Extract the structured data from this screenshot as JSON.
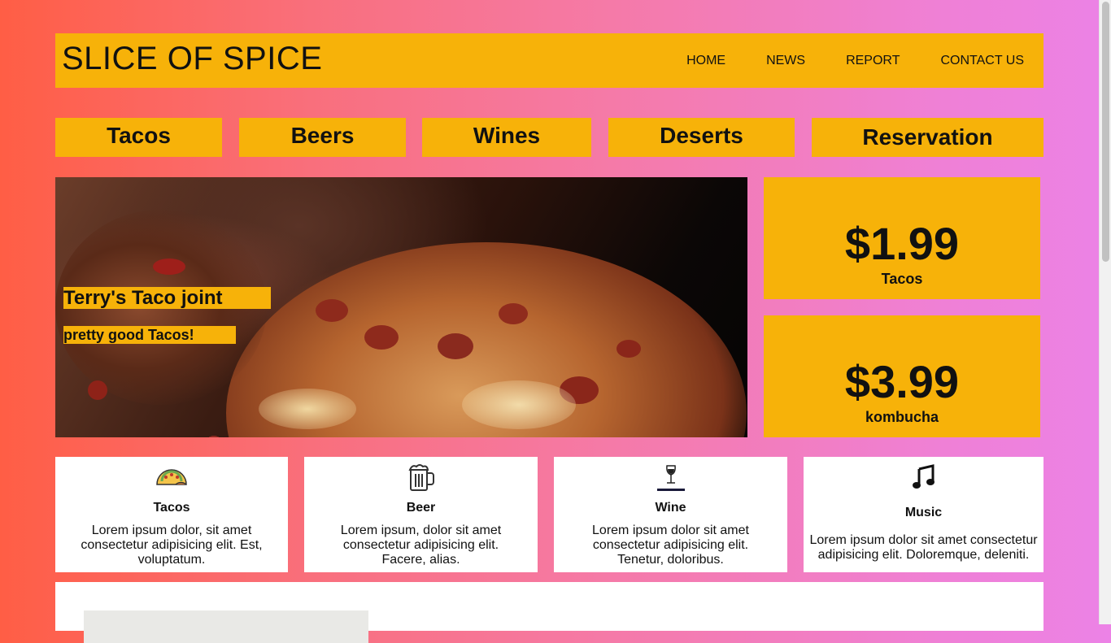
{
  "brand": "SLICE OF SPICE",
  "nav": [
    "HOME",
    "NEWS",
    "REPORT",
    "CONTACT US"
  ],
  "categories": [
    "Tacos",
    "Beers",
    "Wines",
    "Deserts",
    "Reservation"
  ],
  "hero": {
    "title": "Terry's Taco joint",
    "tagline": "pretty good Tacos!"
  },
  "prices": [
    {
      "amount": "$1.99",
      "name": "Tacos"
    },
    {
      "amount": "$3.99",
      "name": "kombucha"
    }
  ],
  "cards": [
    {
      "icon": "taco-icon",
      "title": "Tacos",
      "text": "Lorem ipsum dolor, sit amet consectetur adipisicing elit. Est, voluptatum."
    },
    {
      "icon": "beer-icon",
      "title": "Beer",
      "text": "Lorem ipsum, dolor sit amet consectetur adipisicing elit. Facere, alias."
    },
    {
      "icon": "wine-icon",
      "title": "Wine",
      "text": "Lorem ipsum dolor sit amet consectetur adipisicing elit. Tenetur, doloribus."
    },
    {
      "icon": "music-icon",
      "title": "Music",
      "text": "Lorem ipsum dolor sit amet consectetur adipisicing elit. Doloremque, deleniti."
    }
  ],
  "colors": {
    "accent": "#f7b209",
    "gradient_start": "#ff5e45",
    "gradient_end": "#ec82e6"
  }
}
